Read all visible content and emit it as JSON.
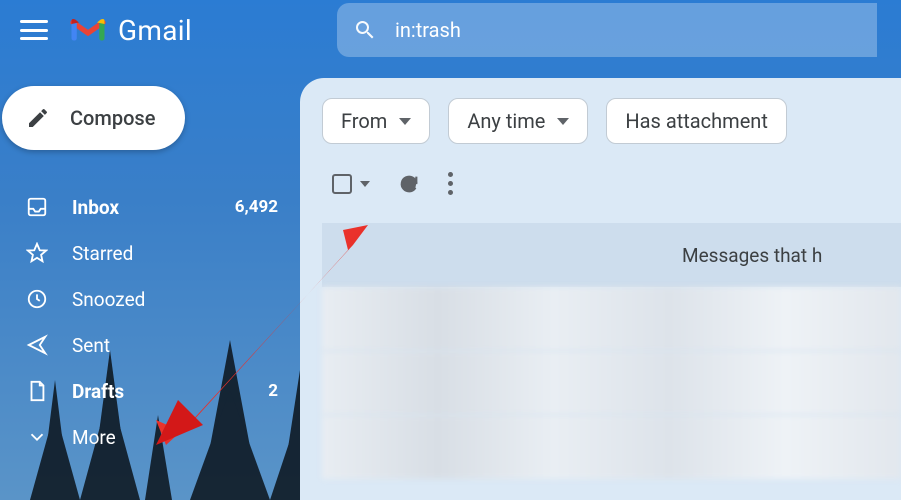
{
  "header": {
    "app_name": "Gmail",
    "search_value": "in:trash"
  },
  "compose": {
    "label": "Compose"
  },
  "sidebar": {
    "items": [
      {
        "label": "Inbox",
        "count": "6,492",
        "bold": true
      },
      {
        "label": "Starred",
        "count": "",
        "bold": false
      },
      {
        "label": "Snoozed",
        "count": "",
        "bold": false
      },
      {
        "label": "Sent",
        "count": "",
        "bold": false
      },
      {
        "label": "Drafts",
        "count": "2",
        "bold": true
      },
      {
        "label": "More",
        "count": "",
        "bold": false
      }
    ]
  },
  "filters": {
    "from": "From",
    "anytime": "Any time",
    "has_attachment": "Has attachment"
  },
  "info_text": "Messages that h"
}
